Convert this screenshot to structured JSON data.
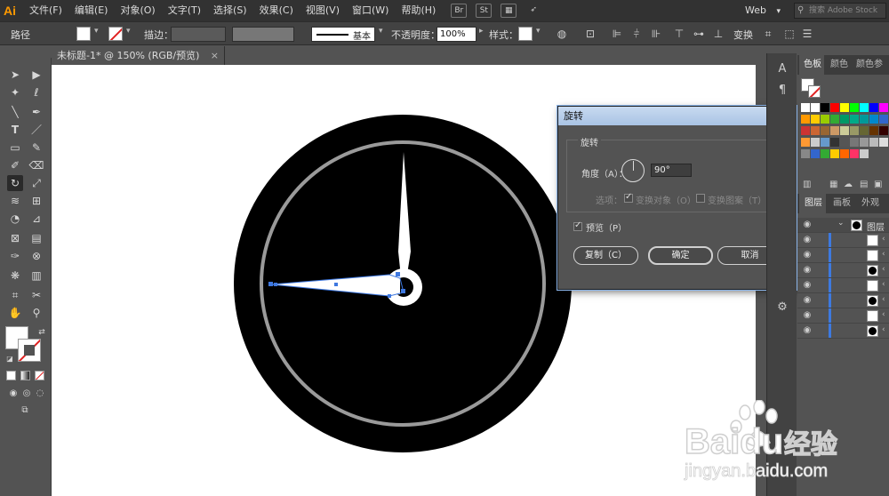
{
  "app": {
    "logo": "Ai",
    "menus": [
      "文件(F)",
      "编辑(E)",
      "对象(O)",
      "文字(T)",
      "选择(S)",
      "效果(C)",
      "视图(V)",
      "窗口(W)",
      "帮助(H)"
    ],
    "bridge_label": "Br",
    "stock_label": "St",
    "workspace": "Web",
    "search_placeholder": "搜索 Adobe Stock"
  },
  "control_bar": {
    "selection_type": "路径",
    "stroke_label": "描边：",
    "stroke_style": "基本",
    "opacity_label": "不透明度：",
    "opacity_value": "100%",
    "style_label": "样式：",
    "transform_label": "变换"
  },
  "document": {
    "tab_title": "未标题-1* @ 150% (RGB/预览)",
    "close_glyph": "×"
  },
  "rotate_dialog": {
    "title": "旋转",
    "group_label": "旋转",
    "angle_label": "角度（A）：",
    "angle_value": "90°",
    "options_label": "选项：",
    "transform_objects_label": "变换对象（O）",
    "transform_patterns_label": "变换图案（T）",
    "preview_label": "预览（P）",
    "copy_button": "复制（C）",
    "ok_button": "确定",
    "cancel_button": "取消"
  },
  "panels": {
    "swatches_tabs": [
      "色板",
      "颜色",
      "颜色参"
    ],
    "layers_tabs": [
      "图层",
      "画板",
      "外观"
    ],
    "layer_name": "图层",
    "swatch_colors": [
      [
        "#ffffff",
        "#ffffff",
        "#000000",
        "#ff0000",
        "#ffff00",
        "#00ff00",
        "#00ffff",
        "#0000ff",
        "#ff00ff"
      ],
      [
        "#ff9900",
        "#ffcc00",
        "#99cc00",
        "#33aa33",
        "#009966",
        "#00aa88",
        "#009999",
        "#0088cc",
        "#3366cc"
      ],
      [
        "#cc3333",
        "#cc6633",
        "#996633",
        "#cc9966",
        "#cccc99",
        "#999966",
        "#666633",
        "#663300",
        "#330000"
      ],
      [
        "#ff9933",
        "#cccccc",
        "#6699cc",
        "#333333",
        "#555555",
        "#777777",
        "#999999",
        "#bbbbbb",
        "#dddddd"
      ],
      [
        "#888888",
        "#3366cc",
        "#33aa33",
        "#ffcc00",
        "#ff6600",
        "#ff3366",
        "#cccccc"
      ]
    ],
    "layer_thumbs": [
      "white",
      "white",
      "black",
      "white",
      "black",
      "white",
      "black"
    ]
  },
  "watermark": {
    "brand": "Baidu",
    "jingyan": "经验",
    "url": "jingyan.baidu.com"
  }
}
